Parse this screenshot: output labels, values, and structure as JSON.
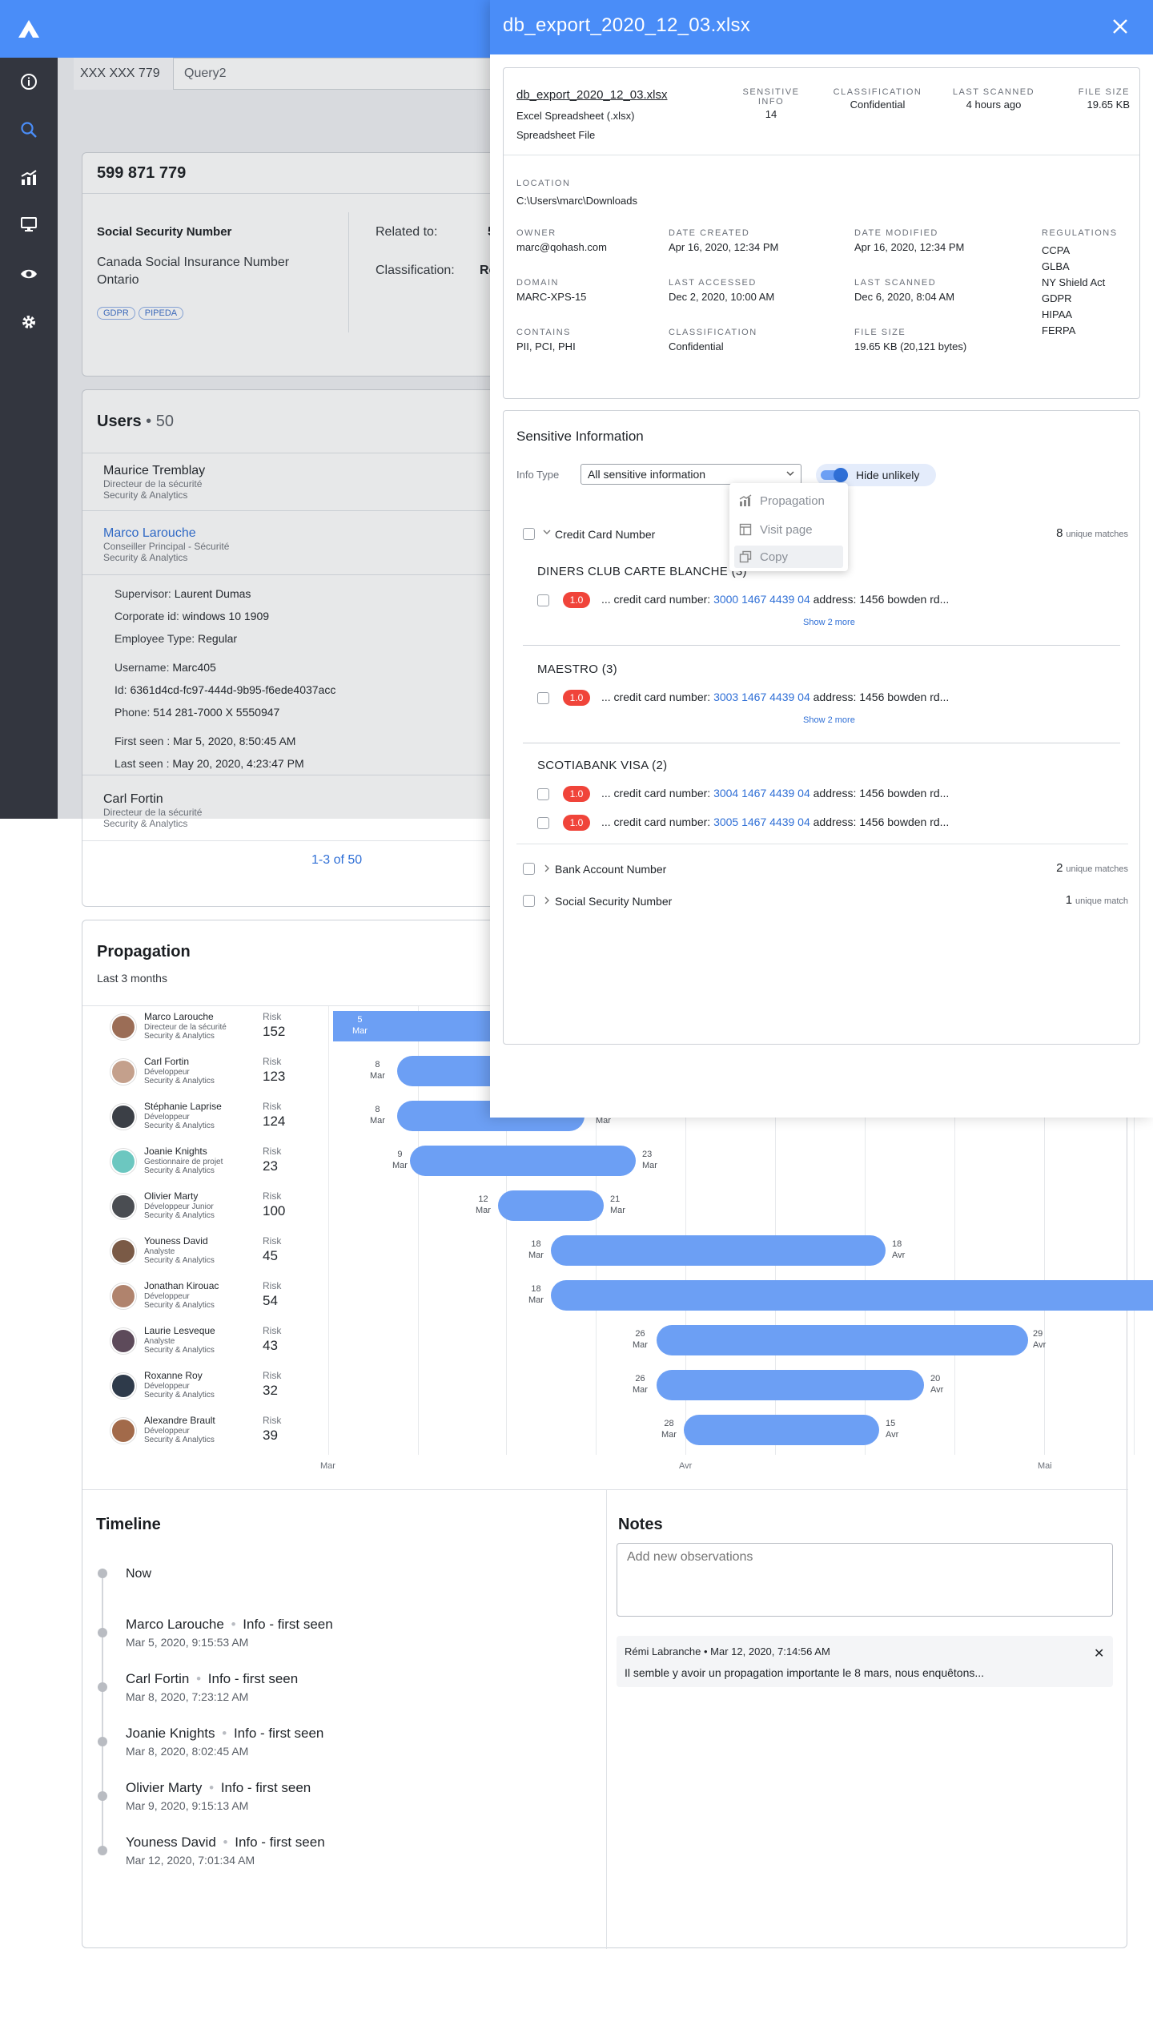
{
  "tabs": [
    "XXX XXX 779",
    "Query2"
  ],
  "entity": {
    "title": "599 871 779",
    "type": "Social Security Number",
    "subtype_line1": "Canada Social Insurance Number",
    "subtype_line2": "Ontario",
    "chips": [
      "GDPR",
      "PIPEDA"
    ],
    "related_label": "Related to:",
    "related_value": "5",
    "classification_label": "Classification:",
    "classification_value": "Re"
  },
  "users": {
    "title": "Users",
    "count": "• 50",
    "list": [
      {
        "name": "Maurice Tremblay",
        "role": "Directeur de la sécurité",
        "team": "Security & Analytics"
      },
      {
        "name": "Marco Larouche",
        "role": "Conseiller Principal - Sécurité",
        "team": "Security & Analytics"
      },
      {
        "name": "Carl Fortin",
        "role": "Directeur de la sécurité",
        "team": "Security & Analytics"
      }
    ],
    "details": {
      "supervisor_label": "Supervisor:",
      "supervisor": "Laurent Dumas",
      "corp_label": "Corporate id:",
      "corp": "windows 10 1909",
      "emp_label": "Employee Type:",
      "emp": "Regular",
      "username_label": "Username:",
      "username": "Marc405",
      "id_label": "Id:",
      "id": "6361d4cd-fc97-444d-9b95-f6ede4037acc",
      "phone_label": "Phone:",
      "phone": "514 281-7000 X 5550947",
      "first_label": "First seen :",
      "first": "Mar 5, 2020, 8:50:45 AM",
      "last_label": "Last seen :",
      "last": "May 20, 2020, 4:23:47 PM"
    },
    "pagination": "1-3 of 50"
  },
  "propagation": {
    "title": "Propagation",
    "subtitle": "Last 3 months",
    "risk_label": "Risk",
    "axis": [
      "Mar",
      "Avr",
      "Mai"
    ],
    "rows": [
      {
        "name": "Marco Larouche",
        "role": "Directeur de la sécurité",
        "team": "Security & Analytics",
        "risk": "152",
        "start": [
          "5",
          "Mar"
        ],
        "end": null
      },
      {
        "name": "Carl Fortin",
        "role": "Développeur",
        "team": "Security & Analytics",
        "risk": "123",
        "start": [
          "8",
          "Mar"
        ],
        "end": null
      },
      {
        "name": "Stéphanie Laprise",
        "role": "Développeur",
        "team": "Security & Analytics",
        "risk": "124",
        "start": [
          "8",
          "Mar"
        ],
        "end": [
          "",
          "Mar"
        ]
      },
      {
        "name": "Joanie Knights",
        "role": "Gestionnaire de projet",
        "team": "Security & Analytics",
        "risk": "23",
        "start": [
          "9",
          "Mar"
        ],
        "end": [
          "23",
          "Mar"
        ]
      },
      {
        "name": "Olivier Marty",
        "role": "Développeur Junior",
        "team": "Security & Analytics",
        "risk": "100",
        "start": [
          "12",
          "Mar"
        ],
        "end": [
          "21",
          "Mar"
        ]
      },
      {
        "name": "Youness David",
        "role": "Analyste",
        "team": "Security & Analytics",
        "risk": "45",
        "start": [
          "18",
          "Mar"
        ],
        "end": [
          "18",
          "Avr"
        ]
      },
      {
        "name": "Jonathan Kirouac",
        "role": "Développeur",
        "team": "Security & Analytics",
        "risk": "54",
        "start": [
          "18",
          "Mar"
        ],
        "end": null
      },
      {
        "name": "Laurie Lesveque",
        "role": "Analyste",
        "team": "Security & Analytics",
        "risk": "43",
        "start": [
          "26",
          "Mar"
        ],
        "end": [
          "29",
          "Avr"
        ]
      },
      {
        "name": "Roxanne Roy",
        "role": "Développeur",
        "team": "Security & Analytics",
        "risk": "32",
        "start": [
          "26",
          "Mar"
        ],
        "end": [
          "20",
          "Avr"
        ]
      },
      {
        "name": "Alexandre Brault",
        "role": "Développeur",
        "team": "Security & Analytics",
        "risk": "39",
        "start": [
          "28",
          "Mar"
        ],
        "end": [
          "15",
          "Avr"
        ]
      }
    ]
  },
  "timeline": {
    "title": "Timeline",
    "now": "Now",
    "events": [
      {
        "name": "Marco Larouche",
        "tag": "Info - first seen",
        "date": "Mar 5, 2020, 9:15:53 AM"
      },
      {
        "name": "Carl Fortin",
        "tag": "Info - first seen",
        "date": "Mar 8, 2020, 7:23:12 AM"
      },
      {
        "name": "Joanie Knights",
        "tag": "Info - first seen",
        "date": "Mar 8, 2020, 8:02:45 AM"
      },
      {
        "name": "Olivier Marty",
        "tag": "Info - first seen",
        "date": "Mar 9, 2020, 9:15:13 AM"
      },
      {
        "name": "Youness David",
        "tag": "Info - first seen",
        "date": "Mar 12, 2020, 7:01:34 AM"
      }
    ]
  },
  "notes": {
    "title": "Notes",
    "placeholder": "Add new observations",
    "entry": {
      "author": "Rémi Labranche",
      "date": "• Mar 12, 2020, 7:14:56 AM",
      "text": "Il semble y avoir un propagation importante le 8 mars, nous enquêtons..."
    }
  },
  "drawer": {
    "title": "db_export_2020_12_03.xlsx",
    "file": {
      "name": "db_export_2020_12_03.xlsx",
      "type": "Excel Spreadsheet (.xlsx)",
      "kind": "Spreadsheet File"
    },
    "stats": [
      {
        "label": "Sensitive Info",
        "value": "14"
      },
      {
        "label": "Classification",
        "value": "Confidential"
      },
      {
        "label": "Last Scanned",
        "value": "4 hours ago"
      },
      {
        "label": "File Size",
        "value": "19.65 KB"
      }
    ],
    "location_label": "Location",
    "location": "C:\\Users\\marc\\Downloads",
    "meta": [
      {
        "label": "Owner",
        "value": "marc@qohash.com"
      },
      {
        "label": "Date Created",
        "value": "Apr 16, 2020, 12:34 PM"
      },
      {
        "label": "Date Modified",
        "value": "Apr 16, 2020, 12:34 PM"
      },
      {
        "label": "Domain",
        "value": "MARC-XPS-15"
      },
      {
        "label": "Last Accessed",
        "value": "Dec 2, 2020, 10:00 AM"
      },
      {
        "label": "Last Scanned",
        "value": "Dec 6, 2020, 8:04 AM"
      },
      {
        "label": "Contains",
        "value": "PII, PCI, PHI"
      },
      {
        "label": "Classification",
        "value": "Confidential"
      },
      {
        "label": "File Size",
        "value": "19.65 KB (20,121 bytes)"
      }
    ],
    "regulations_label": "Regulations",
    "regulations": [
      "CCPA",
      "GLBA",
      "NY Shield Act",
      "GDPR",
      "HIPAA",
      "FERPA"
    ],
    "sensitive": {
      "title": "Sensitive Information",
      "info_type_label": "Info Type",
      "info_type_value": "All sensitive information",
      "toggle_label": "Hide unlikely",
      "menu": [
        "Propagation",
        "Visit page",
        "Copy"
      ],
      "group1": {
        "label": "Credit Card Number",
        "count": "8",
        "unit": "unique matches"
      },
      "cards": [
        {
          "title": "DINERS CLUB CARTE BLANCHE (3)",
          "hits": [
            {
              "score": "1.0",
              "pre": "... credit card number:",
              "num": "3000 1467 4439 04",
              "post": "address: 1456 bowden rd..."
            }
          ],
          "more": "Show 2 more"
        },
        {
          "title": "MAESTRO (3)",
          "hits": [
            {
              "score": "1.0",
              "pre": "... credit card number:",
              "num": "3003 1467 4439 04",
              "post": "address: 1456 bowden rd..."
            }
          ],
          "more": "Show 2 more"
        },
        {
          "title": "SCOTIABANK VISA (2)",
          "hits": [
            {
              "score": "1.0",
              "pre": "... credit card number:",
              "num": "3004 1467 4439 04",
              "post": "address: 1456 bowden rd..."
            },
            {
              "score": "1.0",
              "pre": "... credit card number:",
              "num": "3005 1467 4439 04",
              "post": "address: 1456 bowden rd..."
            }
          ]
        }
      ],
      "group2": {
        "label": "Bank Account Number",
        "count": "2",
        "unit": "unique matches"
      },
      "group3": {
        "label": "Social Security Number",
        "count": "1",
        "unit": "unique match"
      }
    }
  },
  "colors": {
    "accent": "#4a8df8",
    "nav": "#33363f",
    "bar": "#6c9ff4",
    "badge": "#f0443a",
    "link": "#2f6fd6"
  },
  "icons": [
    "logo-icon",
    "info-icon",
    "search-icon",
    "chart-icon",
    "monitor-icon",
    "eye-icon",
    "gear-icon",
    "close-icon",
    "chevron-down-icon",
    "chevron-right-icon"
  ]
}
